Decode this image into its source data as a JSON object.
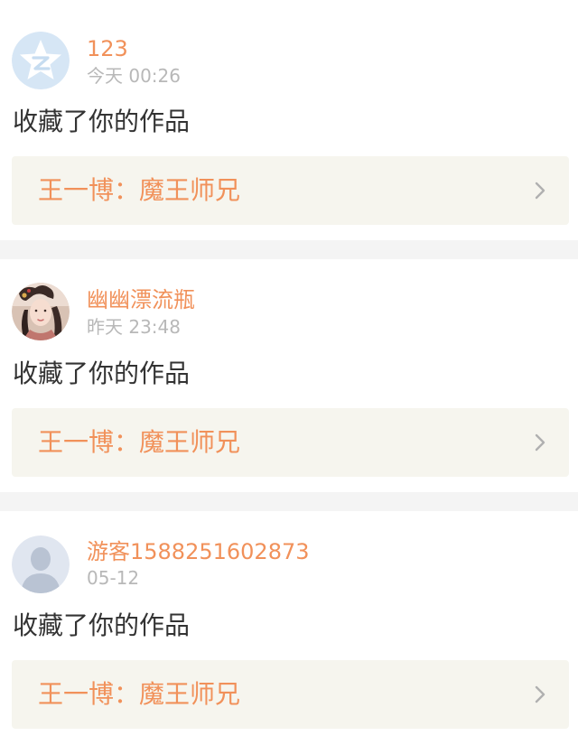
{
  "notifications": [
    {
      "username": "123",
      "time": "今天 00:26",
      "action": "收藏了你的作品",
      "work_title": "王一博：魔王师兄",
      "avatar_icon": "qzone-star-avatar-icon"
    },
    {
      "username": "幽幽漂流瓶",
      "time": "昨天 23:48",
      "action": "收藏了你的作品",
      "work_title": "王一博：魔王师兄",
      "avatar_icon": "user-photo-avatar"
    },
    {
      "username": "游客1588251602873",
      "time": "05-12",
      "action": "收藏了你的作品",
      "work_title": "王一博：魔王师兄",
      "avatar_icon": "default-user-avatar-icon"
    }
  ],
  "colors": {
    "accent": "#f1915a",
    "tab_indicator": "#ee6a96",
    "work_bg": "#f6f5ee",
    "time_text": "#b8b8b8",
    "separator": "#f4f4f4"
  }
}
